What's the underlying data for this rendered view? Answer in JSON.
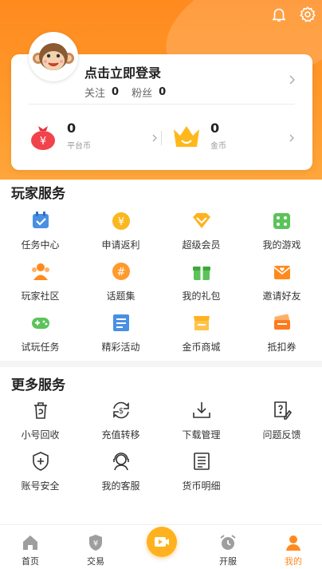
{
  "profile": {
    "login_label": "点击立即登录",
    "follow_label": "关注",
    "follow_count": "0",
    "fans_label": "粉丝",
    "fans_count": "0"
  },
  "wallet": {
    "platform_coin": {
      "value": "0",
      "label": "平台币"
    },
    "gold_coin": {
      "value": "0",
      "label": "金币"
    }
  },
  "player_services": {
    "title": "玩家服务",
    "items": [
      {
        "label": "任务中心",
        "icon": "task-calendar-icon"
      },
      {
        "label": "申请返利",
        "icon": "rebate-coin-icon"
      },
      {
        "label": "超级会员",
        "icon": "vip-diamond-icon"
      },
      {
        "label": "我的游戏",
        "icon": "game-dice-icon"
      },
      {
        "label": "玩家社区",
        "icon": "community-people-icon"
      },
      {
        "label": "话题集",
        "icon": "topic-hash-icon"
      },
      {
        "label": "我的礼包",
        "icon": "gift-box-icon"
      },
      {
        "label": "邀请好友",
        "icon": "invite-mail-icon"
      },
      {
        "label": "试玩任务",
        "icon": "gamepad-icon"
      },
      {
        "label": "精彩活动",
        "icon": "activity-news-icon"
      },
      {
        "label": "金币商城",
        "icon": "shop-store-icon"
      },
      {
        "label": "抵扣券",
        "icon": "coupon-ticket-icon"
      }
    ]
  },
  "more_services": {
    "title": "更多服务",
    "items": [
      {
        "label": "小号回收",
        "icon": "recycle-bin-icon"
      },
      {
        "label": "充值转移",
        "icon": "transfer-dollar-icon"
      },
      {
        "label": "下载管理",
        "icon": "download-icon"
      },
      {
        "label": "问题反馈",
        "icon": "feedback-question-icon"
      },
      {
        "label": "账号安全",
        "icon": "shield-plus-icon"
      },
      {
        "label": "我的客服",
        "icon": "customer-service-icon"
      },
      {
        "label": "货币明细",
        "icon": "ledger-list-icon"
      }
    ]
  },
  "tabbar": {
    "home": "首页",
    "trade": "交易",
    "open_server": "开服",
    "mine": "我的"
  },
  "colors": {
    "accent": "#ff8a1e",
    "center_button": "#ffb21e"
  }
}
